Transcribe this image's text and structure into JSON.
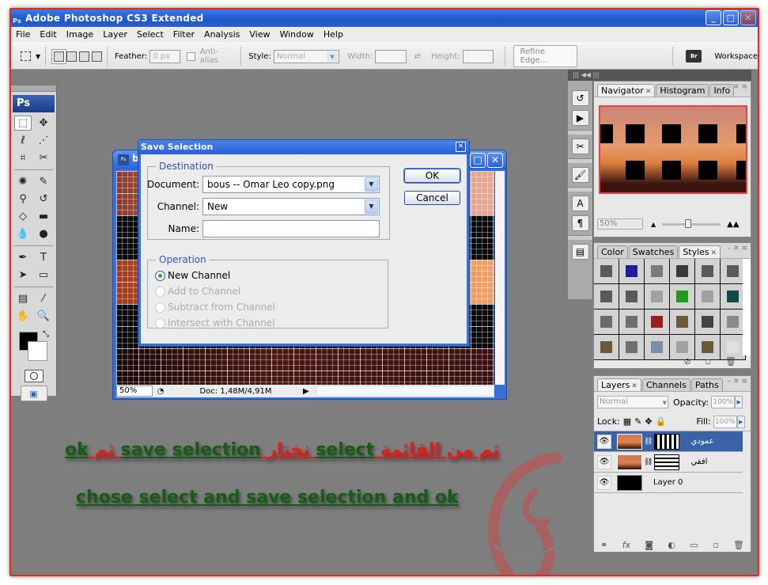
{
  "app": {
    "title": "Adobe Photoshop CS3 Extended",
    "title_icon": "Ps",
    "window_buttons": [
      "minimize",
      "maximize",
      "close"
    ]
  },
  "menubar": [
    "File",
    "Edit",
    "Image",
    "Layer",
    "Select",
    "Filter",
    "Analysis",
    "View",
    "Window",
    "Help"
  ],
  "options_bar": {
    "tool_icon": "rectangular-marquee-icon",
    "feather_label": "Feather:",
    "feather_value": "0 px",
    "antialias_label": "Anti-alias",
    "style_label": "Style:",
    "style_value": "Normal",
    "width_label": "Width:",
    "width_value": "",
    "height_label": "Height:",
    "height_value": "",
    "refine_edge_label": "Refine Edge...",
    "bridge_label": "Br",
    "workspace_label": "Workspace"
  },
  "toolbox": {
    "logo": "Ps",
    "tools": [
      {
        "name": "rectangular-marquee",
        "glyph": "⬚"
      },
      {
        "name": "move",
        "glyph": "✥"
      },
      {
        "name": "lasso",
        "glyph": "ℓ"
      },
      {
        "name": "quick-selection",
        "glyph": "⋰"
      },
      {
        "name": "crop",
        "glyph": "⌗"
      },
      {
        "name": "slice",
        "glyph": "✂"
      },
      {
        "name": "healing-brush",
        "glyph": "✺"
      },
      {
        "name": "brush",
        "glyph": "✎"
      },
      {
        "name": "clone-stamp",
        "glyph": "⚲"
      },
      {
        "name": "history-brush",
        "glyph": "↺"
      },
      {
        "name": "eraser",
        "glyph": "◇"
      },
      {
        "name": "gradient",
        "glyph": "▬"
      },
      {
        "name": "blur",
        "glyph": "💧"
      },
      {
        "name": "dodge",
        "glyph": "●"
      },
      {
        "name": "pen",
        "glyph": "✒"
      },
      {
        "name": "type",
        "glyph": "T"
      },
      {
        "name": "path-selection",
        "glyph": "➤"
      },
      {
        "name": "rectangle-shape",
        "glyph": "▭"
      },
      {
        "name": "notes",
        "glyph": "▤"
      },
      {
        "name": "eyedropper",
        "glyph": "⁄"
      },
      {
        "name": "hand",
        "glyph": "✋"
      },
      {
        "name": "zoom",
        "glyph": "🔍"
      }
    ]
  },
  "document": {
    "title_initial": "b",
    "zoom": "50%",
    "doc_size": "Doc: 1,48M/4,91M"
  },
  "save_selection_dialog": {
    "title": "Save Selection",
    "destination_legend": "Destination",
    "document_label": "Document:",
    "document_value": "bous -- Omar Leo copy.png",
    "channel_label": "Channel:",
    "channel_value": "New",
    "name_label": "Name:",
    "name_value": "",
    "operation_legend": "Operation",
    "operations": [
      {
        "label": "New Channel",
        "checked": true,
        "enabled": true
      },
      {
        "label": "Add to Channel",
        "checked": false,
        "enabled": false
      },
      {
        "label": "Subtract from Channel",
        "checked": false,
        "enabled": false
      },
      {
        "label": "Intersect with Channel",
        "checked": false,
        "enabled": false
      }
    ],
    "ok_label": "OK",
    "cancel_label": "Cancel"
  },
  "navigator_panel": {
    "tabs": [
      "Navigator",
      "Histogram",
      "Info"
    ],
    "active_tab": "Navigator",
    "zoom": "50%",
    "zoom_slider_fraction": 0.45
  },
  "styles_panel": {
    "tabs": [
      "Color",
      "Swatches",
      "Styles"
    ],
    "active_tab": "Styles",
    "swatches": [
      "#5a5a5a",
      "#1e1e9a",
      "#7a7a7a",
      "#3a3a3a",
      "#5a5a5a",
      "#5a5a5a",
      "#5a5a5a",
      "#5a5a5a",
      "#a0a0a0",
      "#1e9a1e",
      "#a0a0a0",
      "#114a48",
      "#6a6a6a",
      "#6e6e6e",
      "#9a1e1e",
      "#6a5a3a",
      "#444444",
      "#8a8a8a",
      "#6a5a3a",
      "#707070",
      "#7a8ea8",
      "#a0a0a0",
      "#6a5a3a",
      "#e0e0e0"
    ]
  },
  "layers_panel": {
    "tabs": [
      "Layers",
      "Channels",
      "Paths"
    ],
    "active_tab": "Layers",
    "blend_mode": "Normal",
    "opacity_label": "Opacity:",
    "opacity_value": "100%",
    "lock_label": "Lock:",
    "fill_label": "Fill:",
    "fill_value": "100%",
    "layers": [
      {
        "name": "عمودي",
        "mask": "vertical-stripes",
        "selected": true,
        "visible": true
      },
      {
        "name": "افقي",
        "mask": "horizontal-stripes",
        "selected": false,
        "visible": true
      },
      {
        "name": "Layer 0",
        "mask": "none",
        "selected": false,
        "visible": true
      }
    ]
  },
  "captions": {
    "line1_parts": [
      {
        "text": "ok",
        "color": "green"
      },
      {
        "text": " ثم ",
        "color": "red"
      },
      {
        "text": "save selection",
        "color": "green"
      },
      {
        "text": " نختار ",
        "color": "red"
      },
      {
        "text": "select",
        "color": "green"
      },
      {
        "text": " ثم من القائمة",
        "color": "red"
      }
    ],
    "line2": "chose select  and save selection and ok"
  },
  "colors": {
    "accent_blue": "#2a5fd6",
    "caption_green": "#135e13",
    "caption_red": "#e21b1b",
    "frame_red": "#e02a1a"
  }
}
